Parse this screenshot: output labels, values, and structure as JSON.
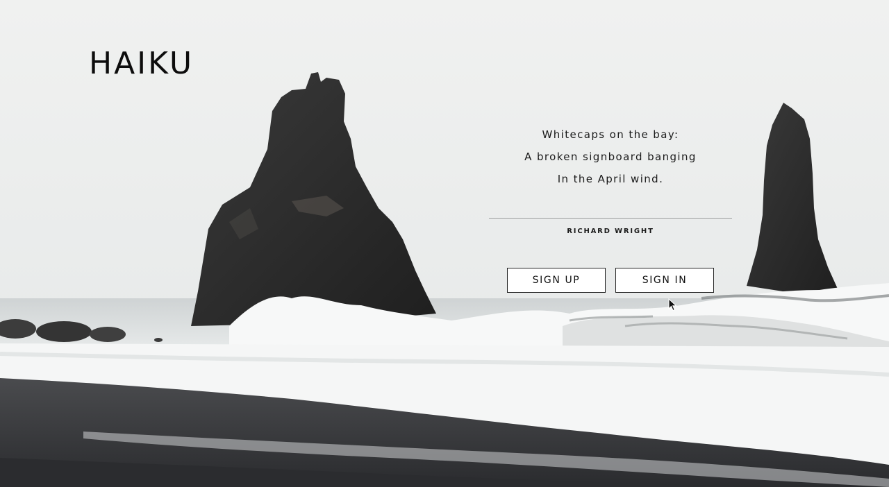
{
  "brand": {
    "logo": "HAIKU"
  },
  "poem": {
    "lines": [
      "Whitecaps on the bay:",
      "A broken signboard banging",
      "In the April wind."
    ],
    "author": "RICHARD WRIGHT"
  },
  "actions": {
    "sign_up_label": "SIGN UP",
    "sign_in_label": "SIGN IN"
  },
  "icons": {
    "cursor": "mouse-pointer-icon"
  },
  "colors": {
    "sky": "#eef0ef",
    "rock": "#2d2d2d",
    "sand": "#3a3a3c",
    "foam": "#f6f7f7",
    "text": "#111111"
  }
}
